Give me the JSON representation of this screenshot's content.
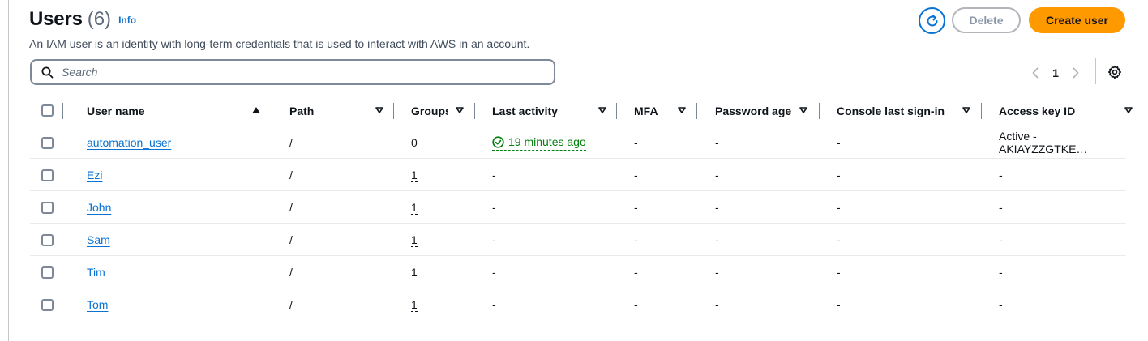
{
  "header": {
    "title": "Users",
    "count": "(6)",
    "info": "Info",
    "description": "An IAM user is an identity with long-term credentials that is used to interact with AWS in an account."
  },
  "actions": {
    "refresh_icon": "refresh-icon",
    "delete_label": "Delete",
    "create_label": "Create user",
    "accent": "#ff9900"
  },
  "search": {
    "placeholder": "Search",
    "value": ""
  },
  "pagination": {
    "page": "1"
  },
  "columns": {
    "user_name": "User name",
    "path": "Path",
    "groups": "Groups",
    "last_activity": "Last activity",
    "mfa": "MFA",
    "password_age": "Password age",
    "console_sign_in": "Console last sign-in",
    "access_key": "Access key ID"
  },
  "rows": [
    {
      "user": "automation_user",
      "path": "/",
      "groups": "0",
      "activity": "19 minutes ago",
      "mfa": "-",
      "pwd": "-",
      "console": "-",
      "key": "Active - AKIAYZZGTKE…"
    },
    {
      "user": "Ezi",
      "path": "/",
      "groups": "1",
      "activity": "-",
      "mfa": "-",
      "pwd": "-",
      "console": "-",
      "key": "-"
    },
    {
      "user": "John",
      "path": "/",
      "groups": "1",
      "activity": "-",
      "mfa": "-",
      "pwd": "-",
      "console": "-",
      "key": "-"
    },
    {
      "user": "Sam",
      "path": "/",
      "groups": "1",
      "activity": "-",
      "mfa": "-",
      "pwd": "-",
      "console": "-",
      "key": "-"
    },
    {
      "user": "Tim",
      "path": "/",
      "groups": "1",
      "activity": "-",
      "mfa": "-",
      "pwd": "-",
      "console": "-",
      "key": "-"
    },
    {
      "user": "Tom",
      "path": "/",
      "groups": "1",
      "activity": "-",
      "mfa": "-",
      "pwd": "-",
      "console": "-",
      "key": "-"
    }
  ],
  "colors": {
    "link": "#0972d3",
    "success": "#037f0c"
  }
}
